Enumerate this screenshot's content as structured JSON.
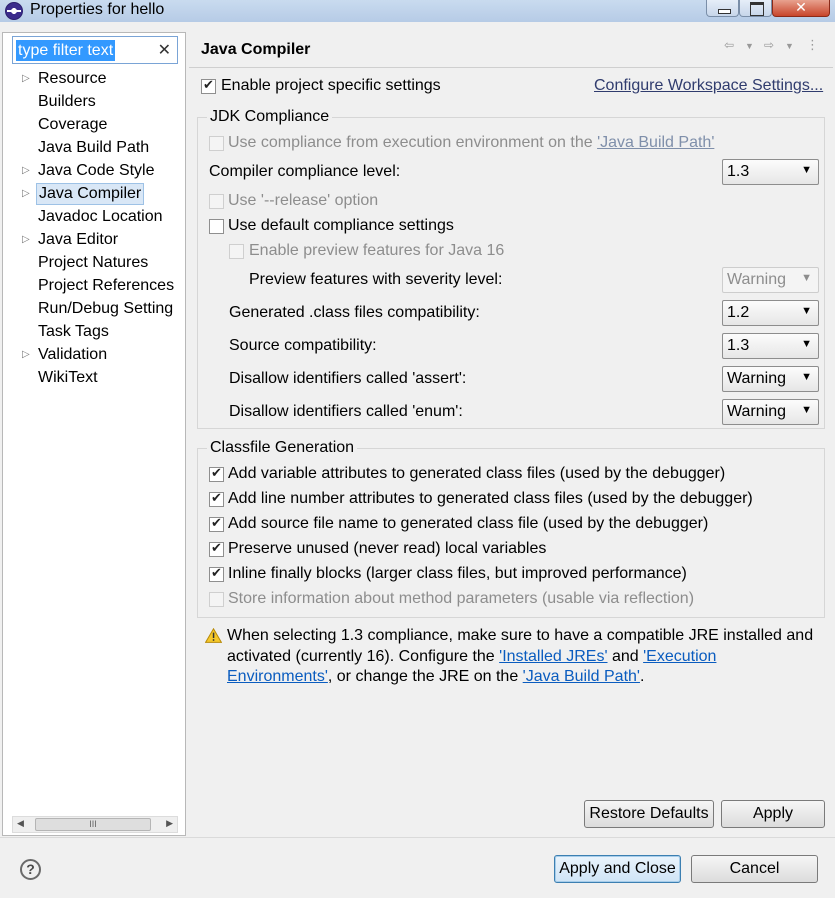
{
  "window": {
    "title": "Properties for hello"
  },
  "sidebar": {
    "filter_text": "type filter text",
    "items": [
      {
        "label": "Resource",
        "expandable": true
      },
      {
        "label": "Builders",
        "expandable": false
      },
      {
        "label": "Coverage",
        "expandable": false
      },
      {
        "label": "Java Build Path",
        "expandable": false
      },
      {
        "label": "Java Code Style",
        "expandable": true
      },
      {
        "label": "Java Compiler",
        "expandable": true,
        "selected": true
      },
      {
        "label": "Javadoc Location",
        "expandable": false
      },
      {
        "label": "Java Editor",
        "expandable": true
      },
      {
        "label": "Project Natures",
        "expandable": false
      },
      {
        "label": "Project References",
        "expandable": false
      },
      {
        "label": "Run/Debug Setting",
        "expandable": false
      },
      {
        "label": "Task Tags",
        "expandable": false
      },
      {
        "label": "Validation",
        "expandable": true
      },
      {
        "label": "WikiText",
        "expandable": false
      }
    ],
    "scroll_thumb": "III"
  },
  "main": {
    "title": "Java Compiler",
    "enable_project": {
      "label": "Enable project specific settings",
      "checked": true
    },
    "configure_workspace_link": "Configure Workspace Settings...",
    "jdk": {
      "group_label": "JDK Compliance",
      "use_compliance_env": {
        "text": "Use compliance from execution environment on the ",
        "link": "'Java Build Path'",
        "checked": false
      },
      "compiler_level": {
        "label": "Compiler compliance level:",
        "value": "1.3"
      },
      "use_release": {
        "label": "Use '--release' option",
        "checked": false
      },
      "use_default": {
        "label": "Use default compliance settings",
        "checked": false
      },
      "enable_preview": {
        "label": "Enable preview features for Java 16",
        "checked": false
      },
      "preview_severity": {
        "label": "Preview features with severity level:",
        "value": "Warning"
      },
      "generated_class": {
        "label": "Generated .class files compatibility:",
        "value": "1.2"
      },
      "source_compat": {
        "label": "Source compatibility:",
        "value": "1.3"
      },
      "disallow_assert": {
        "label": "Disallow identifiers called 'assert':",
        "value": "Warning"
      },
      "disallow_enum": {
        "label": "Disallow identifiers called 'enum':",
        "value": "Warning"
      }
    },
    "classfile": {
      "group_label": "Classfile Generation",
      "options": [
        {
          "label": "Add variable attributes to generated class files (used by the debugger)",
          "checked": true,
          "enabled": true
        },
        {
          "label": "Add line number attributes to generated class files (used by the debugger)",
          "checked": true,
          "enabled": true
        },
        {
          "label": "Add source file name to generated class file (used by the debugger)",
          "checked": true,
          "enabled": true
        },
        {
          "label": "Preserve unused (never read) local variables",
          "checked": true,
          "enabled": true
        },
        {
          "label": "Inline finally blocks (larger class files, but improved performance)",
          "checked": true,
          "enabled": true
        },
        {
          "label": "Store information about method parameters (usable via reflection)",
          "checked": false,
          "enabled": false
        }
      ]
    },
    "warning": {
      "t1": "When selecting 1.3 compliance, make sure to have a compatible JRE installed and activated (currently 16). Configure the ",
      "link1": "'Installed JREs'",
      "t2": " and ",
      "link2": "'Execution Environments'",
      "t3": ", or change the JRE on the ",
      "link3": "'Java Build Path'",
      "t4": "."
    },
    "restore_defaults": "Restore Defaults",
    "apply": "Apply"
  },
  "footer": {
    "help": "?",
    "apply_and_close": "Apply and Close",
    "cancel": "Cancel"
  }
}
